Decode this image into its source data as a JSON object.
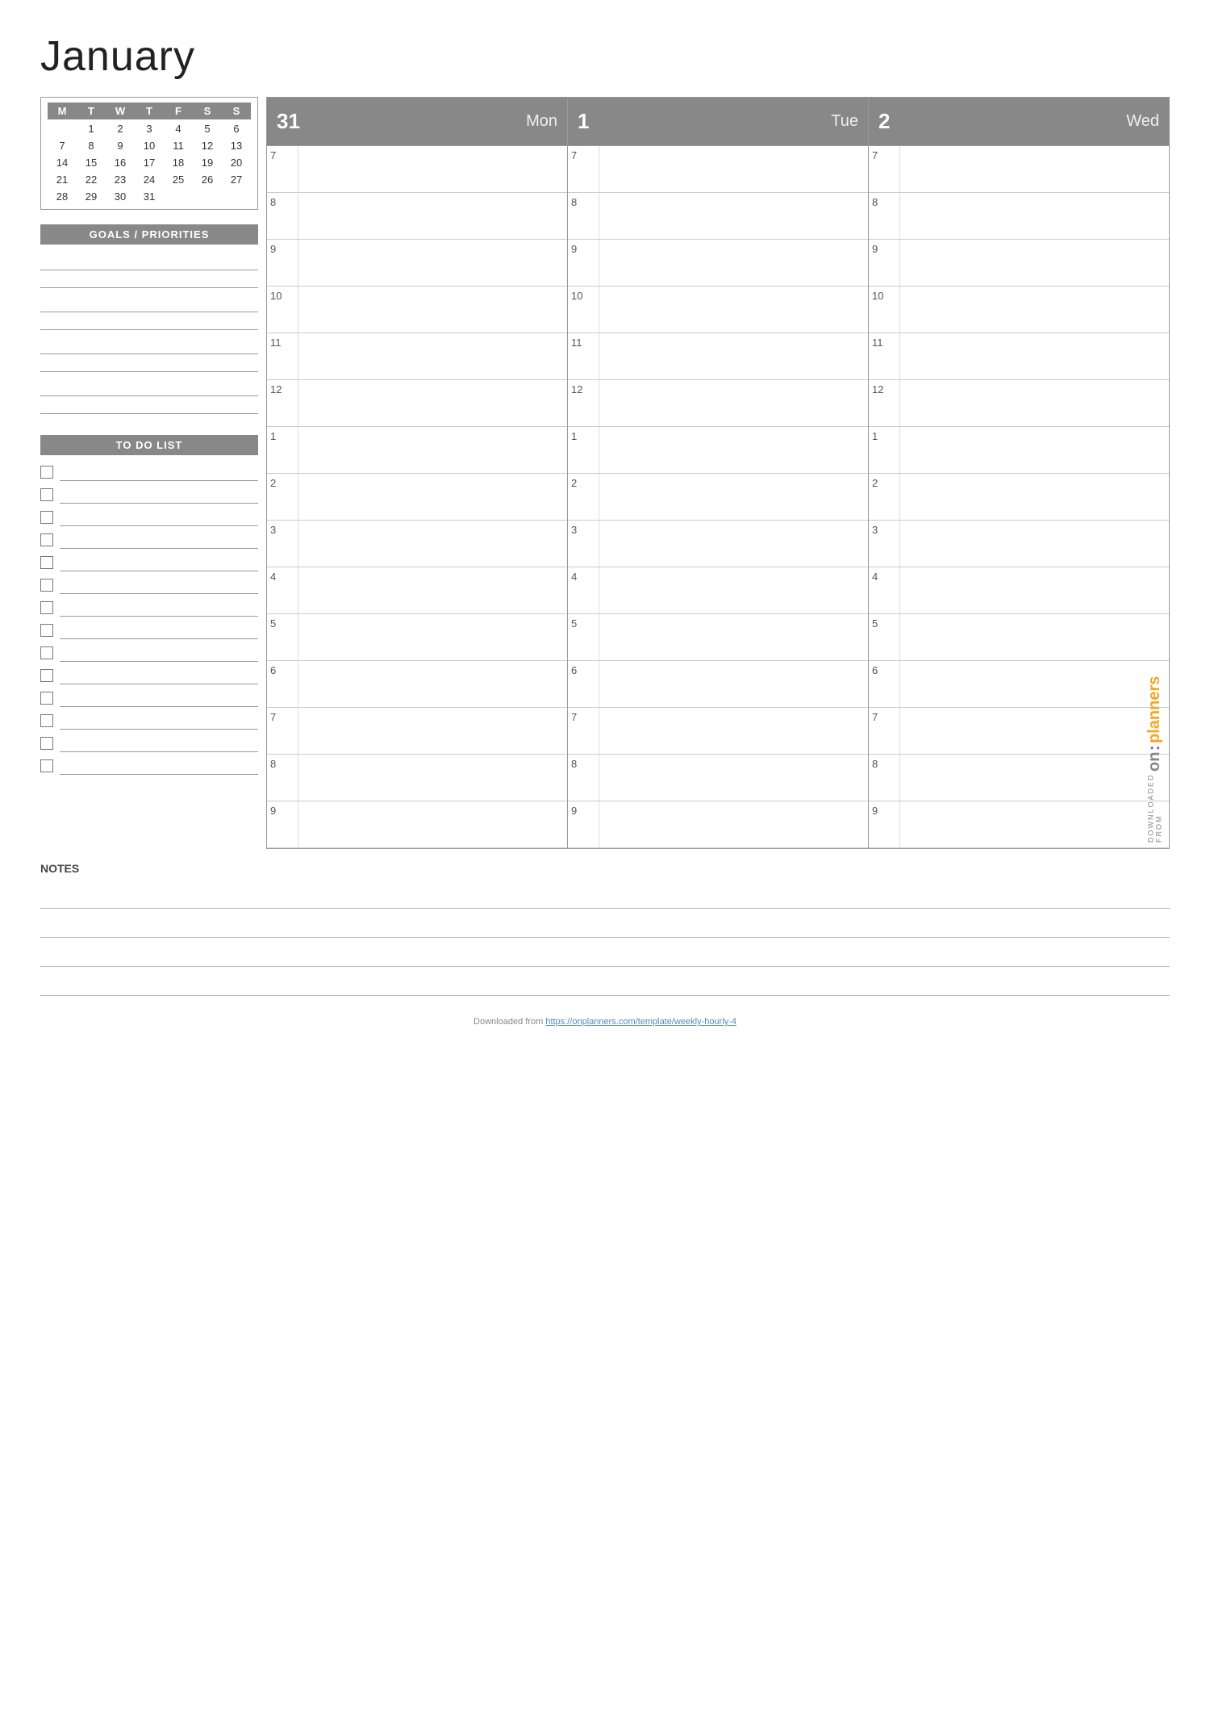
{
  "page": {
    "title": "January"
  },
  "mini_calendar": {
    "headers": [
      "M",
      "T",
      "W",
      "T",
      "F",
      "S",
      "S"
    ],
    "rows": [
      [
        "",
        "1",
        "2",
        "3",
        "4",
        "5",
        "6"
      ],
      [
        "7",
        "8",
        "9",
        "10",
        "11",
        "12",
        "13"
      ],
      [
        "14",
        "15",
        "16",
        "17",
        "18",
        "19",
        "20"
      ],
      [
        "21",
        "22",
        "23",
        "24",
        "25",
        "26",
        "27"
      ],
      [
        "28",
        "29",
        "30",
        "31",
        "",
        "",
        ""
      ]
    ]
  },
  "goals_section": {
    "label": "GOALS / PRIORITIES",
    "lines_count": 8
  },
  "todo_section": {
    "label": "TO DO LIST",
    "items_count": 14
  },
  "notes_section": {
    "label": "NOTES",
    "lines_count": 4
  },
  "days": [
    {
      "num": "31",
      "name": "Mon"
    },
    {
      "num": "1",
      "name": "Tue"
    },
    {
      "num": "2",
      "name": "Wed"
    }
  ],
  "time_slots": [
    {
      "label": "7"
    },
    {
      "label": "8"
    },
    {
      "label": "9"
    },
    {
      "label": "10"
    },
    {
      "label": "11"
    },
    {
      "label": "12"
    },
    {
      "label": "1"
    },
    {
      "label": "2"
    },
    {
      "label": "3"
    },
    {
      "label": "4"
    },
    {
      "label": "5"
    },
    {
      "label": "6"
    },
    {
      "label": "7"
    },
    {
      "label": "8"
    },
    {
      "label": "9"
    }
  ],
  "watermark": {
    "downloaded_text": "DOWNLOADED FROM",
    "brand_on": "on",
    "brand_colon": ":",
    "brand_planners": "planners"
  },
  "footer": {
    "url_text": "Downloaded from",
    "url": "https://onplanners.com/template/weekly-hourly-4"
  }
}
